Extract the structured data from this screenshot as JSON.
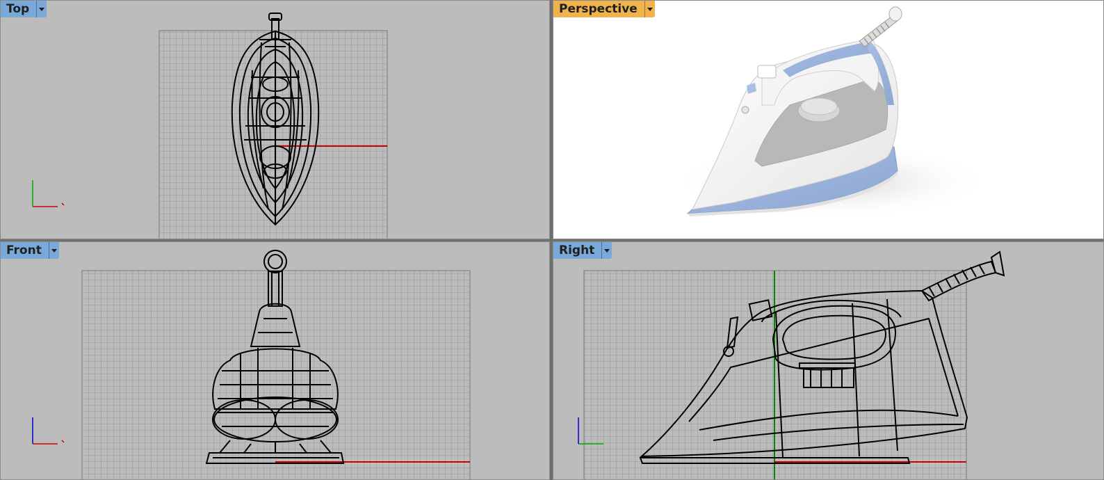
{
  "viewports": [
    {
      "id": "top",
      "label": "Top",
      "active": false,
      "tab_color": "#79a9d8"
    },
    {
      "id": "perspective",
      "label": "Perspective",
      "active": true,
      "tab_color": "#f0b24a"
    },
    {
      "id": "front",
      "label": "Front",
      "active": false,
      "tab_color": "#79a9d8"
    },
    {
      "id": "right",
      "label": "Right",
      "active": false,
      "tab_color": "#79a9d8"
    }
  ],
  "colors": {
    "viewport_bg": "#bcbcbc",
    "grid_line": "#8e8e8e",
    "x_axis": "#cc0000",
    "y_axis": "#00aa00",
    "z_axis": "#0000cc",
    "iron_blue": "#9db4dc",
    "iron_white": "#f7f7f7"
  },
  "icons": {
    "tab_menu": "chevron-down-icon",
    "axes": "axis-triad-icon"
  },
  "models": {
    "subject": "steam iron",
    "render_modes": {
      "top": "wireframe",
      "perspective": "rendered",
      "front": "wireframe",
      "right": "wireframe"
    }
  }
}
